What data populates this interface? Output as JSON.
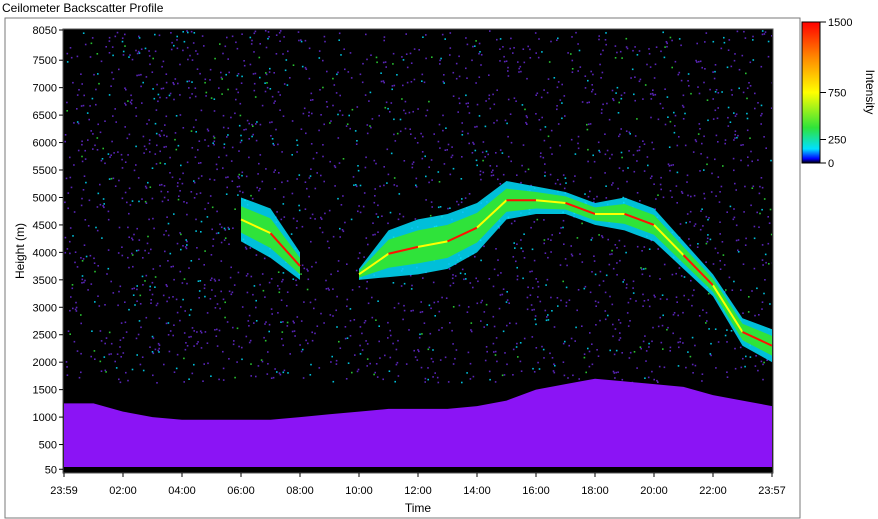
{
  "panel": {
    "title": "Ceilometer Backscatter Profile"
  },
  "chart_data": {
    "type": "heatmap",
    "xlabel": "Time",
    "ylabel": "Height (m)",
    "x_tick_labels": [
      "23:59",
      "02:00",
      "04:00",
      "06:00",
      "08:00",
      "10:00",
      "12:00",
      "14:00",
      "16:00",
      "18:00",
      "20:00",
      "22:00",
      "23:57"
    ],
    "x_tick_hours": [
      0,
      2,
      4,
      6,
      8,
      10,
      12,
      14,
      16,
      18,
      20,
      22,
      24
    ],
    "y_ticks": [
      50,
      500,
      1000,
      1500,
      2000,
      2500,
      3000,
      3500,
      4000,
      4500,
      5000,
      5500,
      6000,
      6500,
      7000,
      7500,
      8050
    ],
    "ylim": [
      0,
      8050
    ],
    "colorbar": {
      "label": "Intensity",
      "ticks": [
        0,
        250,
        750,
        1500
      ],
      "tick_labels": [
        "0",
        "250",
        "750",
        "1500"
      ],
      "range": [
        0,
        1500
      ]
    },
    "colors": {
      "background": "#000000",
      "noise": "#6a2bd9",
      "surface_layer": "#8b14f5",
      "low": "#00e0ff",
      "mid": "#2fe33a",
      "high": "#ffff00",
      "peak": "#ff1200"
    },
    "layers": {
      "boundary_layer_top_m": [
        1250,
        1250,
        1100,
        1000,
        950,
        950,
        950,
        950,
        1000,
        1050,
        1100,
        1150,
        1150,
        1150,
        1200,
        1300,
        1500,
        1600,
        1700,
        1650,
        1600,
        1550,
        1400,
        1300,
        1200
      ],
      "cloud_base_m": [
        null,
        null,
        null,
        null,
        null,
        null,
        4200,
        3900,
        3500,
        null,
        3500,
        3550,
        3600,
        3700,
        4000,
        4600,
        4700,
        4700,
        4500,
        4400,
        4200,
        3700,
        3200,
        2300,
        2000
      ],
      "cloud_top_m": [
        null,
        null,
        null,
        null,
        null,
        null,
        5000,
        4800,
        4000,
        null,
        3700,
        4400,
        4600,
        4700,
        4900,
        5300,
        5200,
        5100,
        4900,
        5000,
        4800,
        4200,
        3600,
        2800,
        2600
      ]
    }
  }
}
